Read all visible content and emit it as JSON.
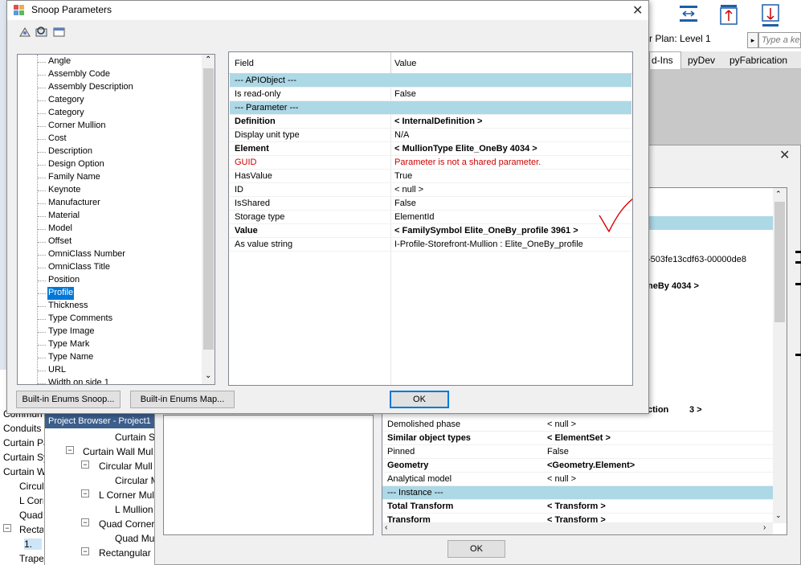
{
  "main_dialog": {
    "title": "Snoop Parameters",
    "param_list": [
      "Angle",
      "Assembly Code",
      "Assembly Description",
      "Category",
      "Category",
      "Corner Mullion",
      "Cost",
      "Description",
      "Design Option",
      "Family Name",
      "Keynote",
      "Manufacturer",
      "Material",
      "Model",
      "Offset",
      "OmniClass Number",
      "OmniClass Title",
      "Position",
      "Profile",
      "Thickness",
      "Type Comments",
      "Type Image",
      "Type Mark",
      "Type Name",
      "URL",
      "Width on side 1"
    ],
    "selected_param": "Profile",
    "grid": {
      "col_field": "Field",
      "col_value": "Value",
      "rows": [
        {
          "field": "--- APIObject ---",
          "value": "",
          "style": "hdr"
        },
        {
          "field": "Is read-only",
          "value": "False",
          "style": ""
        },
        {
          "field": "--- Parameter ---",
          "value": "",
          "style": "hdr"
        },
        {
          "field": "Definition",
          "value": "< InternalDefinition >",
          "style": "bold"
        },
        {
          "field": "Display unit type",
          "value": "N/A",
          "style": ""
        },
        {
          "field": "Element",
          "value": "< MullionType  Elite_OneBy  4034 >",
          "style": "bold"
        },
        {
          "field": "GUID",
          "value": "Parameter is not a shared parameter.",
          "style": "red"
        },
        {
          "field": "HasValue",
          "value": "True",
          "style": ""
        },
        {
          "field": "ID",
          "value": "< null >",
          "style": ""
        },
        {
          "field": "IsShared",
          "value": "False",
          "style": ""
        },
        {
          "field": "Storage type",
          "value": "ElementId",
          "style": ""
        },
        {
          "field": "Value",
          "value": "< FamilySymbol  Elite_OneBy_profile  3961 >",
          "style": "bold"
        },
        {
          "field": "As value string",
          "value": "I-Profile-Storefront-Mullion : Elite_OneBy_profile",
          "style": ""
        }
      ]
    },
    "btn_enums_snoop": "Built-in Enums Snoop...",
    "btn_enums_map": "Built-in Enums Map...",
    "btn_ok": "OK"
  },
  "second_dialog": {
    "partial_1": "-503fe13cdf63-00000de8",
    "partial_2": "neBy  4034 >",
    "partial_3": "ction",
    "partial_3_val": "3 >",
    "rows": [
      {
        "field": "Demolished phase",
        "value": "< null >",
        "style": ""
      },
      {
        "field": "Similar object types",
        "value": "< ElementSet >",
        "style": "bold"
      },
      {
        "field": "Pinned",
        "value": "False",
        "style": ""
      },
      {
        "field": "Geometry",
        "value": "<Geometry.Element>",
        "style": "bold"
      },
      {
        "field": "Analytical model",
        "value": "< null >",
        "style": ""
      },
      {
        "field": "--- Instance ---",
        "value": "",
        "style": "hdr"
      },
      {
        "field": "Total Transform",
        "value": "< Transform >",
        "style": "bold"
      },
      {
        "field": "Transform",
        "value": "< Transform >",
        "style": "bold"
      }
    ],
    "btn_ok": "OK"
  },
  "revit": {
    "view_label": "r Plan: Level 1",
    "search_placeholder": "Type a key",
    "tabs": [
      "d-Ins",
      "pyDev",
      "pyFabrication"
    ],
    "project_browser_title": "Project Browser - Project1",
    "left_items": [
      "Commun",
      "Conduits",
      "Curtain Pa",
      "Curtain Sy",
      "Curtain W",
      "Circul",
      "L Corn",
      "Quad",
      "Recta",
      "1.",
      "Trapez"
    ],
    "tree_items": [
      "Curtain S",
      "Curtain Wall Mul",
      "Circular Mull",
      "Circular M",
      "L Corner Mul",
      "L Mullion",
      "Quad Corner",
      "Quad Mu",
      "Rectangular"
    ]
  }
}
